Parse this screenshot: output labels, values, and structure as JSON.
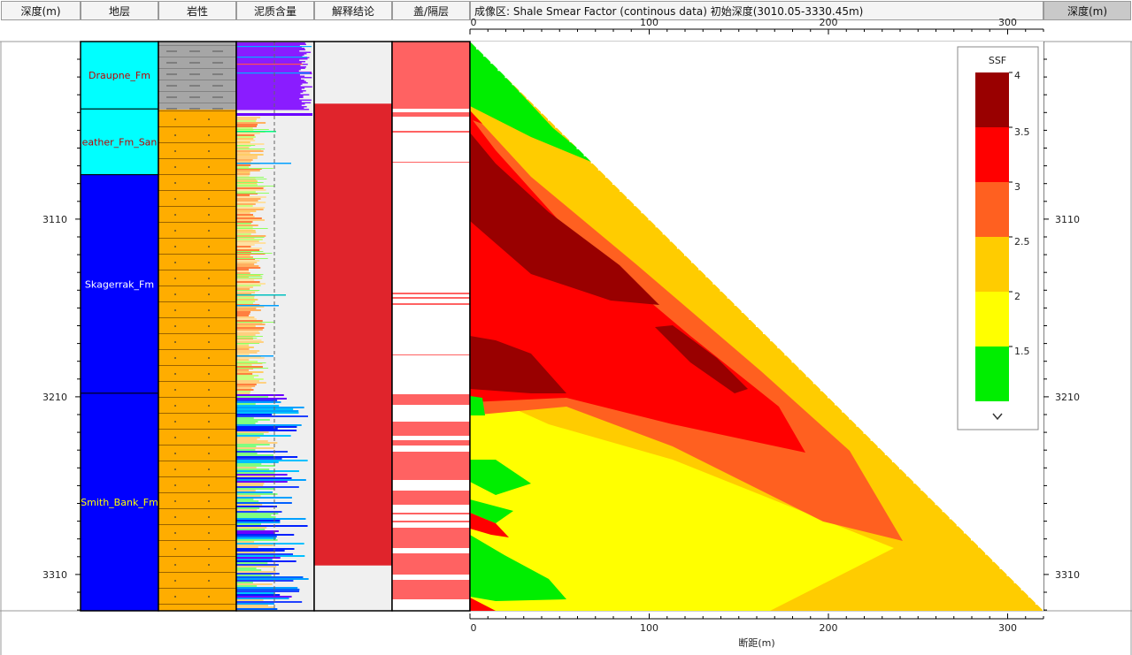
{
  "headers": {
    "depth_left": "深度(m)",
    "strata": "地层",
    "lithology": "岩性",
    "shale_content": "泥质含量",
    "interpretation": "解释结论",
    "seal": "盖/隔层",
    "section_title": "成像区: Shale Smear Factor (continous data)  初始深度(3010.05-3330.45m)",
    "depth_right": "深度(m)"
  },
  "depth_axis": {
    "ticks": [
      3110,
      3210,
      3310
    ]
  },
  "strata": [
    {
      "name": "Draupne_Fm",
      "top": 3010.05,
      "base": 3048,
      "color": "#00ffff",
      "text_color": "#c00000"
    },
    {
      "name": "eather_Fm_San",
      "top": 3048,
      "base": 3085,
      "color": "#00ffff",
      "text_color": "#c00000"
    },
    {
      "name": "Skagerrak_Fm",
      "top": 3085,
      "base": 3208,
      "color": "#0000ff",
      "text_color": "#ffffff"
    },
    {
      "name": "Smith_Bank_Fm",
      "top": 3208,
      "base": 3330.45,
      "color": "#0000ff",
      "text_color": "#ffff00"
    }
  ],
  "interpretation": [
    {
      "top": 3010.05,
      "base": 3045,
      "color": "#f0f0f0"
    },
    {
      "top": 3045,
      "base": 3305,
      "color": "#e0242c"
    },
    {
      "top": 3305,
      "base": 3330.45,
      "color": "#f0f0f0"
    }
  ],
  "chart_data": {
    "type": "heatmap",
    "title": "Shale Smear Factor (continous data)",
    "xlabel": "断距(m)",
    "x_ticks": [
      0,
      100,
      200,
      300
    ],
    "xlim": [
      0,
      320
    ],
    "ylim": [
      3010.05,
      3330.45
    ],
    "legend": {
      "title": "SSF",
      "placement": "top-right",
      "levels": [
        {
          "label": "4",
          "color": "#990000"
        },
        {
          "label": "3.5",
          "color": "#ff0000"
        },
        {
          "label": "3",
          "color": "#ff6020"
        },
        {
          "label": "2.5",
          "color": "#ffcc00"
        },
        {
          "label": "2",
          "color": "#ffff00"
        },
        {
          "label": "1.5",
          "color": "#00ee00"
        }
      ],
      "more_icon": "chevron-down-icon"
    }
  }
}
